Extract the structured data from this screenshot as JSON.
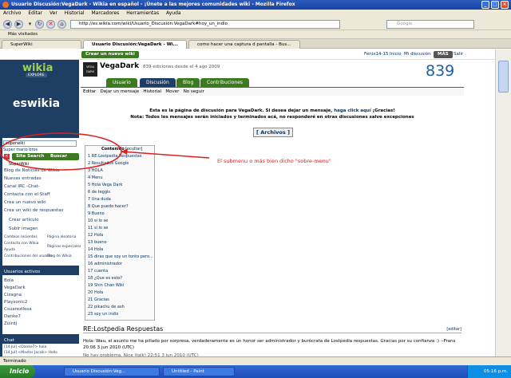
{
  "browser": {
    "title": "Usuario Discusión:VegaDark - Wikia en español - ¡Únete a las mejores comunidades wiki - Mozilla Firefox",
    "menu": [
      "Archivo",
      "Editar",
      "Ver",
      "Historial",
      "Marcadores",
      "Herramientas",
      "Ayuda"
    ],
    "url": "http://es.wikia.com/wiki/Usuario_Discusión:VegaDark#hoy_un_indio",
    "search_placeholder": "Google",
    "bookmarks": "Más visitados",
    "tabs": [
      "SuperWiki",
      "Usuario Discusión:VegaDark - Wi...",
      "como hacer una captura d pantalla - Bus..."
    ],
    "status": "Terminado"
  },
  "wikia": {
    "create_wiki": "Crear un nuevo wiki",
    "user": "Fenix14-15",
    "home": "Inicio",
    "mywiki": "Mi discusión",
    "more": "MÁS",
    "logout": "Salir",
    "logo": "wikia",
    "explore": "EXPLORE",
    "eswikia": "eswikia",
    "search_value": "superwiki",
    "suggest": "Super mario bros",
    "site_search": "Site Search",
    "buscar_web": "Buscar Web",
    "suggest2": "SuperWiki",
    "nav_items": [
      "Blog de Noticias de Wikia",
      "Nuevas entradas",
      "Canal IRC -Chat-",
      "Contacta con el Staff",
      "Crea un nuevo wiki",
      "Crea un wiki de respuestas"
    ],
    "actions": [
      "Crear artículo",
      "Subir imagen"
    ],
    "links": [
      "Cambios recientes",
      "Contacta con Wikia",
      "Ayuda",
      "Contribuciones del usuario",
      "Página aleatoria",
      "Páginas especiales",
      "Blog de Wikia"
    ],
    "users_header": "Usuarios activos",
    "users": [
      "Bola",
      "VegaDark",
      "Cizagna",
      "Playsonic2",
      "Csuarezllosa",
      "Danke7",
      "Zuirdj"
    ],
    "chat_header": "Chat",
    "chat": [
      "[14 Jul] <Danke7> hola",
      "[14 Jul] <Master Jacob> Hello",
      "[14 Jul] <Fenix14-15> hola"
    ]
  },
  "profile": {
    "name": "VegaDark",
    "avatar": "VEGA DARK",
    "edits": "839 ediciones desde el 4 ago 2009",
    "count": "839",
    "tabs": [
      "Usuario",
      "Discusión",
      "Blog",
      "Contribuciones"
    ],
    "actions": [
      "Editar",
      "Dejar un mensaje",
      "Historial",
      "Mover",
      "No seguir"
    ]
  },
  "talk": {
    "intro1": "Esta es la página de discusión para VegaDark. Si desea dejar un mensaje,",
    "intro_link": "haga click aquí",
    "intro1b": "¡Gracias!",
    "intro2": "Nota: Todos los mensajes serán iniciados y terminados acá, no responderé en otras discusiones salve excepciones",
    "archive": "[ Archivos ]",
    "toc_head": "Contenido",
    "toc_hide": "[ocultar]",
    "toc": [
      "1 RE:Lostpedia Respuestas",
      "2 Resultados Google",
      "3 HOLA",
      "4 Menu",
      "5 Hola Vega Dark",
      "6 de teggis",
      "7 Una duda",
      "8 Que puedo hacer?",
      "9 Bueno",
      "10 si lo se",
      "11 si lo se",
      "12 Hola",
      "13 bueno",
      "14 Hola",
      "15 diras que soy un tonto pero...",
      "16 administrador",
      "17 cuenta",
      "18 ¿Que es esto?",
      "19 Shin Chan Wiki",
      "20 Hola",
      "21 Gracias",
      "22 pikachu de ash",
      "23 soy un indio"
    ],
    "annotation": "El submenu o más bien dicho \"sobre-menu\"",
    "section_title": "RE:Lostpedia Respuestas",
    "section_edit": "[editar]",
    "body": "Hola: Wau, el asunto me ha pillado por sorpresa, verdaderamente es un honor ser administrador y burócrata de Lostpedia respuestas. Gracias por su confianza :) --Frans 20:06 3 jun 2010 (UTC)",
    "body2": "No hay problema. Nice (talk) 22:51 3 jun 2010 (UTC)"
  },
  "taskbar": {
    "start": "Inicio",
    "tasks": [
      "Usuario Discusión:Veg...",
      "Untitled - Paint"
    ],
    "clock": "05:16 p.m."
  },
  "colors": {
    "wiki_green": "#3c7a1f",
    "sidebar": "#1f3e63",
    "annotation": "#e02020"
  }
}
